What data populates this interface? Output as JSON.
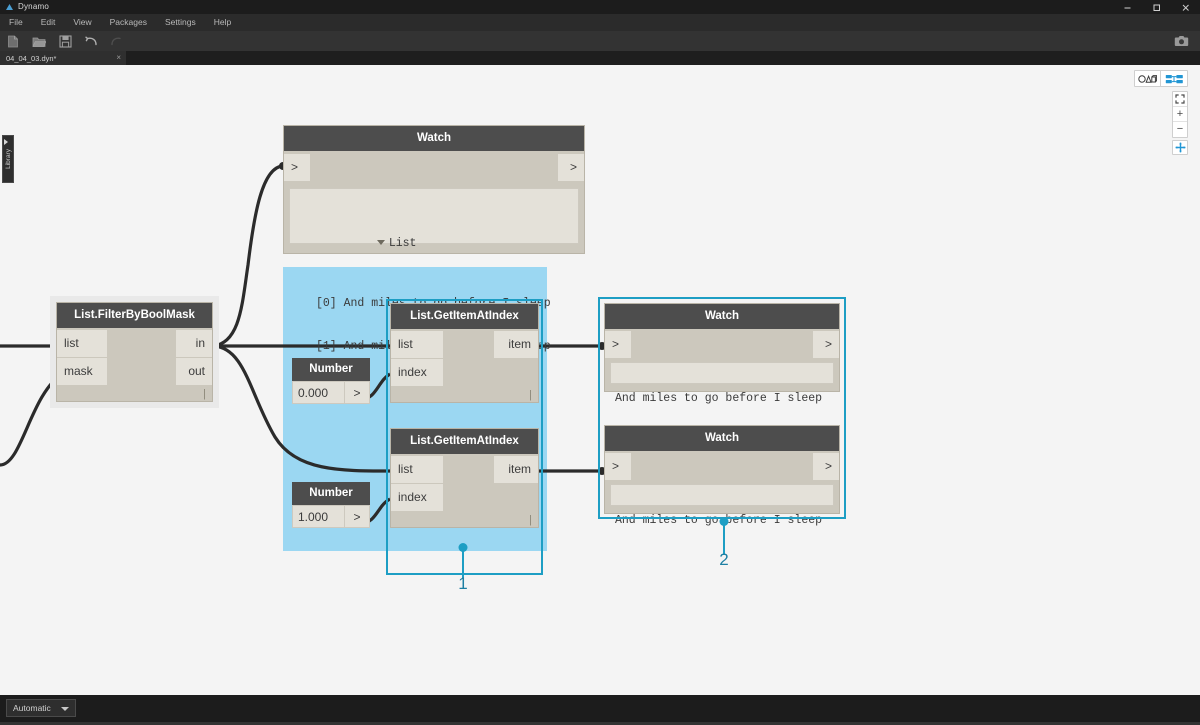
{
  "window": {
    "title": "Dynamo",
    "app_icon": "dynamo-logo-icon",
    "controls": {
      "minimize": "minimize-icon",
      "maximize": "maximize-icon",
      "close": "close-icon"
    }
  },
  "menubar": {
    "items": [
      {
        "label": "File"
      },
      {
        "label": "Edit"
      },
      {
        "label": "View"
      },
      {
        "label": "Packages"
      },
      {
        "label": "Settings"
      },
      {
        "label": "Help"
      }
    ]
  },
  "toolbar": {
    "icons": [
      {
        "name": "new-file-icon"
      },
      {
        "name": "open-folder-icon"
      },
      {
        "name": "save-icon"
      },
      {
        "name": "undo-icon"
      },
      {
        "name": "redo-icon"
      }
    ],
    "screenshot_icon": "camera-icon"
  },
  "tabbar": {
    "tabs": [
      {
        "label": "04_04_03.dyn*",
        "close": "×",
        "active": true
      }
    ]
  },
  "sidebar": {
    "library_label": "Library",
    "expand_icon": "chevron-right-icon"
  },
  "canvas_controls": {
    "view_toggle": [
      {
        "name": "geometry-view-icon",
        "active": false
      },
      {
        "name": "graph-view-icon",
        "active": true
      }
    ],
    "zoom_to_fit": "zoom-to-fit-icon",
    "zoom_in": "+",
    "zoom_out": "−",
    "pan": "pan-icon"
  },
  "graph": {
    "nodes": [
      {
        "id": "watch-top",
        "type": "Watch",
        "title": "Watch",
        "in_ports": [
          ">"
        ],
        "out_ports": [
          ">"
        ],
        "result_lines": [
          "List",
          "    [0] And miles to go before I sleep",
          "    [1] And miles to go before I sleep"
        ],
        "result_root": "List",
        "result_items": [
          "[0] And miles to go before I sleep",
          "[1] And miles to go before I sleep"
        ],
        "selected": false
      },
      {
        "id": "filter-bool-mask",
        "type": "List.FilterByBoolMask",
        "title": "List.FilterByBoolMask",
        "in_ports": [
          "list",
          "mask"
        ],
        "out_ports": [
          "in",
          "out"
        ],
        "footer": "|",
        "selected": false
      },
      {
        "id": "get-item-1",
        "type": "List.GetItemAtIndex",
        "title": "List.GetItemAtIndex",
        "in_ports": [
          "list",
          "index"
        ],
        "out_ports": [
          "item"
        ],
        "footer": "|",
        "selected": true
      },
      {
        "id": "get-item-2",
        "type": "List.GetItemAtIndex",
        "title": "List.GetItemAtIndex",
        "in_ports": [
          "list",
          "index"
        ],
        "out_ports": [
          "item"
        ],
        "footer": "|",
        "selected": true
      },
      {
        "id": "number-1",
        "type": "Number",
        "title": "Number",
        "value": "0.000",
        "out_port": ">",
        "selected": false
      },
      {
        "id": "number-2",
        "type": "Number",
        "title": "Number",
        "value": "1.000",
        "out_port": ">",
        "selected": false
      },
      {
        "id": "watch-right-1",
        "type": "Watch",
        "title": "Watch",
        "in_ports": [
          ">"
        ],
        "out_ports": [
          ">"
        ],
        "result_items": [
          "And miles to go before I sleep"
        ],
        "selected": true
      },
      {
        "id": "watch-right-2",
        "type": "Watch",
        "title": "Watch",
        "in_ports": [
          ">"
        ],
        "out_ports": [
          ">"
        ],
        "result_items": [
          "And miles to go before I sleep"
        ],
        "selected": true
      }
    ]
  },
  "callouts": [
    {
      "number": "1"
    },
    {
      "number": "2"
    }
  ],
  "statusbar": {
    "run_mode": "Automatic",
    "caret_icon": "chevron-down-icon"
  },
  "colors": {
    "accent_teal": "#1d9ec4",
    "highlight_blue": "#9bd7f2",
    "node_body": "#ccc8bd",
    "node_header": "#4d4d4d",
    "port_bg": "#e4e1d9",
    "canvas_bg": "#f4f4f4"
  }
}
